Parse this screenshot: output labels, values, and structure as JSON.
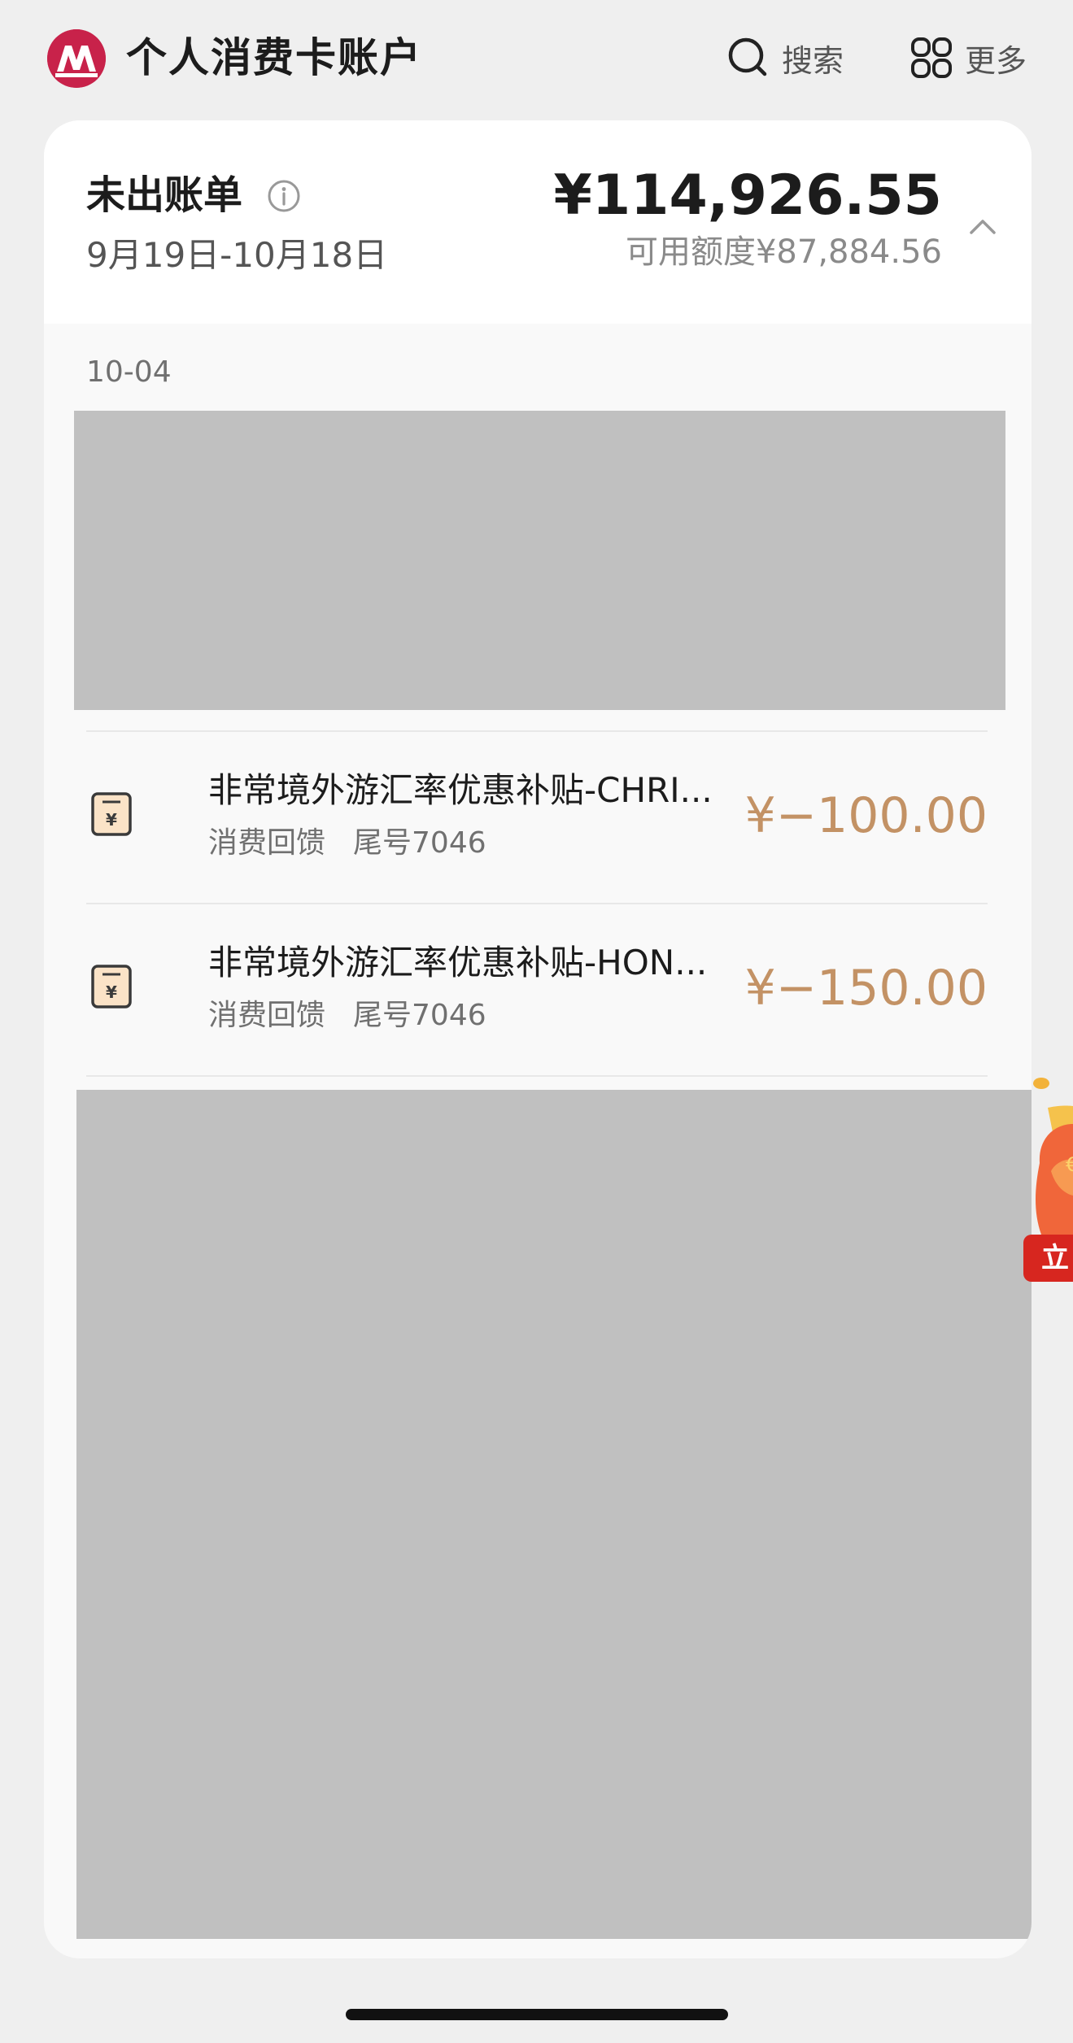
{
  "header": {
    "title": "个人消费卡账户",
    "search_label": "搜索",
    "more_label": "更多"
  },
  "bill": {
    "title": "未出账单",
    "period": "9月19日-10月18日",
    "amount": "¥114,926.55",
    "available": "可用额度¥87,884.56"
  },
  "date_group": "10-04",
  "transactions": [
    {
      "title": "非常境外游汇率优惠补贴-CHRI...",
      "category": "消费回馈",
      "card_tail": "尾号7046",
      "amount": "¥−100.00"
    },
    {
      "title": "非常境外游汇率优惠补贴-HON...",
      "category": "消费回馈",
      "card_tail": "尾号7046",
      "amount": "¥−150.00"
    }
  ],
  "promo": {
    "button_label": "立"
  },
  "colors": {
    "brand": "#c8224a",
    "amount": "#c39265",
    "redaction": "#c0c0c0",
    "promo": "#d7261f"
  }
}
